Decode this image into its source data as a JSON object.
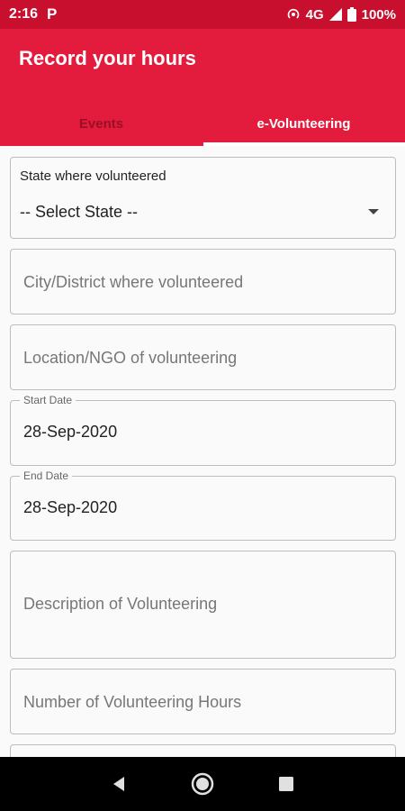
{
  "status": {
    "time": "2:16",
    "app_mark": "P",
    "network": "4G",
    "battery": "100%"
  },
  "appbar": {
    "title": "Record your hours"
  },
  "tabs": [
    {
      "label": "Events",
      "active": false
    },
    {
      "label": "e-Volunteering",
      "active": true
    }
  ],
  "form": {
    "state": {
      "label": "State where volunteered",
      "value": "-- Select State --"
    },
    "city": {
      "placeholder": "City/District where volunteered"
    },
    "location": {
      "placeholder": "Location/NGO of volunteering"
    },
    "start_date": {
      "label": "Start Date",
      "value": "28-Sep-2020"
    },
    "end_date": {
      "label": "End Date",
      "value": "28-Sep-2020"
    },
    "description": {
      "placeholder": "Description of Volunteering"
    },
    "hours": {
      "placeholder": "Number of Volunteering Hours"
    }
  },
  "colors": {
    "statusbar": "#c8102e",
    "appbar": "#e31c3d",
    "inactive_tab": "#9b0f25"
  },
  "nav": {
    "icons": [
      "back-icon",
      "home-icon",
      "recents-icon"
    ]
  }
}
